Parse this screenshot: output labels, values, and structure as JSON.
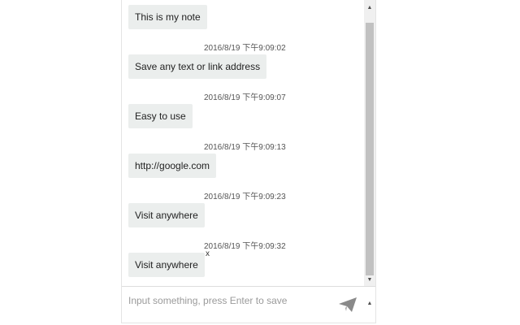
{
  "notes": [
    {
      "text": "This is my note",
      "timestamp": ""
    },
    {
      "text": "Save any text or link address",
      "timestamp": "2016/8/19 下午9:09:02"
    },
    {
      "text": "Easy to use",
      "timestamp": "2016/8/19 下午9:09:07"
    },
    {
      "text": "http://google.com",
      "timestamp": "2016/8/19 下午9:09:13"
    },
    {
      "text": "Visit anywhere",
      "timestamp": "2016/8/19 下午9:09:23"
    },
    {
      "text": "Visit anywhere",
      "timestamp": "2016/8/19 下午9:09:32",
      "delete_label": "x"
    }
  ],
  "input": {
    "placeholder": "Input something, press Enter to save",
    "value": ""
  },
  "icons": {
    "send": "paper-plane-icon",
    "scroll_up": "triangle-up-icon",
    "scroll_down": "triangle-down-icon"
  },
  "colors": {
    "bubble_bg": "#ebeeed",
    "scroll_thumb": "#c1c1c1"
  }
}
